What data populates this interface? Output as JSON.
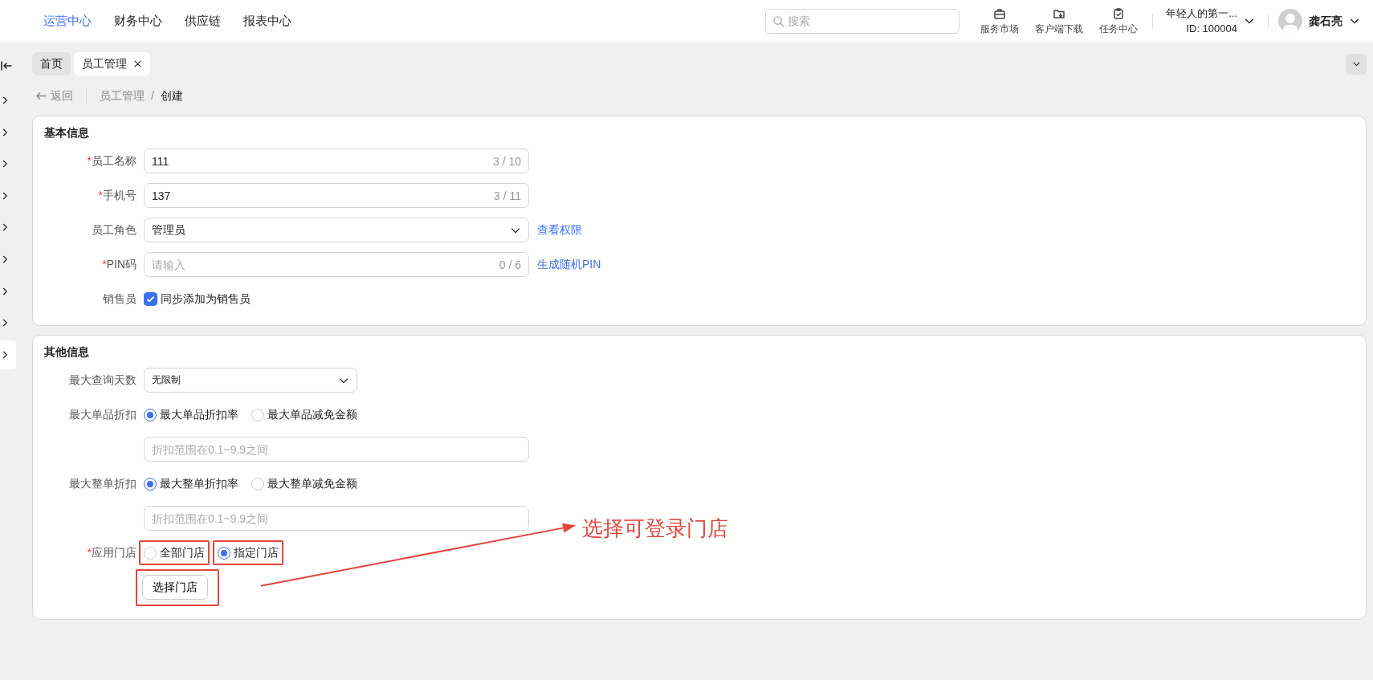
{
  "top_nav": {
    "items": [
      {
        "label": "运营中心",
        "selected": true
      },
      {
        "label": "财务中心",
        "selected": false
      },
      {
        "label": "供应链",
        "selected": false
      },
      {
        "label": "报表中心",
        "selected": false
      }
    ],
    "search": {
      "placeholder": "搜索"
    },
    "tools": [
      {
        "label": "服务市场",
        "kind": "briefcase"
      },
      {
        "label": "客户端下载",
        "kind": "download"
      },
      {
        "label": "任务中心",
        "kind": "clipboard"
      }
    ],
    "account": {
      "name": "年轻人的第一...",
      "id": "ID: 100004"
    },
    "user": {
      "name": "龚石亮"
    }
  },
  "sidebar": {
    "items": [
      {
        "selected": false
      },
      {
        "selected": false
      },
      {
        "selected": false
      },
      {
        "selected": false
      },
      {
        "selected": false
      },
      {
        "selected": false
      },
      {
        "selected": false
      },
      {
        "selected": false
      },
      {
        "selected": true
      }
    ]
  },
  "tabs": [
    {
      "label": "首页",
      "selected": false
    },
    {
      "label": "员工管理",
      "selected": true,
      "closable": true
    }
  ],
  "breadcrumb": {
    "back": "返回",
    "items": [
      "员工管理",
      "创建"
    ],
    "separator": "/"
  },
  "sections": [
    {
      "title": "基本信息",
      "fields": [
        {
          "kind": "input",
          "label": "员工名称",
          "required_mark": "*",
          "value": "111",
          "counter": "3 / 10"
        },
        {
          "kind": "input",
          "label": "手机号",
          "required_mark": "*",
          "value": "137",
          "counter": "3 / 11"
        },
        {
          "kind": "select",
          "label": "员工角色",
          "value": "管理员",
          "link": "查看权限"
        },
        {
          "kind": "input",
          "label": "PIN码",
          "required_mark": "*",
          "placeholder": "请输入",
          "counter": "0 / 6",
          "link": "生成随机PIN"
        },
        {
          "kind": "checkbox",
          "label": "销售员",
          "checked": true,
          "text": "同步添加为销售员"
        }
      ]
    },
    {
      "title": "其他信息",
      "fields": [
        {
          "kind": "select",
          "label": "最大查询天数",
          "value": "无限制"
        },
        {
          "kind": "radio",
          "label": "最大单品折扣",
          "options": [
            {
              "label": "最大单品折扣率",
              "selected": true
            },
            {
              "label": "最大单品减免金额",
              "selected": false
            }
          ],
          "placeholder": "折扣范围在0.1~9.9之间"
        },
        {
          "kind": "radio",
          "label": "最大整单折扣",
          "options": [
            {
              "label": "最大整单折扣率",
              "selected": true
            },
            {
              "label": "最大整单减免金额",
              "selected": false
            }
          ],
          "placeholder": "折扣范围在0.1~9.9之间"
        },
        {
          "kind": "radio",
          "label": "应用门店",
          "required_mark": "*",
          "options": [
            {
              "label": "全部门店",
              "selected": false,
              "highlighted": true
            },
            {
              "label": "指定门店",
              "selected": true,
              "highlighted": true
            }
          ],
          "button": {
            "label": "选择门店",
            "highlighted": true
          }
        }
      ]
    }
  ],
  "annotation": {
    "text": "选择可登录门店"
  }
}
